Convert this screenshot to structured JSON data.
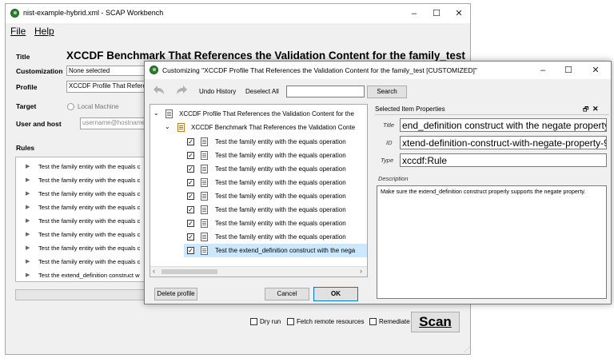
{
  "main_window": {
    "title": "nist-example-hybrid.xml - SCAP Workbench",
    "minimize": "–",
    "maximize": "☐",
    "close": "✕"
  },
  "menu": {
    "file": "File",
    "help": "Help"
  },
  "form": {
    "title_label": "Title",
    "title_value": "XCCDF Benchmark That References the Validation Content for the family_test",
    "customization_label": "Customization",
    "customization_value": "None selected",
    "profile_label": "Profile",
    "profile_value": "XCCDF Profile That References",
    "target_label": "Target",
    "local_machine": "Local Machine",
    "user_host_label": "User and host",
    "user_host_placeholder": "username@hostname",
    "rules_label": "Rules"
  },
  "rules": [
    "Test the family entity with the equals c",
    "Test the family entity with the equals c",
    "Test the family entity with the equals c",
    "Test the family entity with the equals c",
    "Test the family entity with the equals c",
    "Test the family entity with the equals c",
    "Test the family entity with the equals c",
    "Test the family entity with the equals c",
    "Test the extend_definition construct w"
  ],
  "bottom": {
    "dry_run": "Dry run",
    "fetch_remote": "Fetch remote resources",
    "remediate": "Remediate",
    "scan": "Scan"
  },
  "dialog": {
    "title": "Customizing \"XCCDF Profile That References the Validation Content for the family_test [CUSTOMIZED]\"",
    "minimize": "–",
    "maximize": "☐",
    "close": "✕",
    "undo_history": "Undo History",
    "deselect_all": "Deselect All",
    "search_value": "",
    "search_button": "Search",
    "tree_profile": "XCCDF Profile That References the Validation Content for the",
    "tree_benchmark": "XCCDF Benchmark That References the Validation Conte",
    "tree_items": [
      "Test the family entity with the equals operation",
      "Test the family entity with the equals operation",
      "Test the family entity with the equals operation",
      "Test the family entity with the equals operation",
      "Test the family entity with the equals operation",
      "Test the family entity with the equals operation",
      "Test the family entity with the equals operation",
      "Test the family entity with the equals operation",
      "Test the extend_definition construct with the nega"
    ],
    "delete_profile": "Delete profile",
    "cancel": "Cancel",
    "ok": "OK",
    "props_header": "Selected Item Properties",
    "title_field_label": "Title",
    "title_field_value": "end_definition construct with the negate property",
    "id_field_label": "ID",
    "id_field_value": "xtend-definition-construct-with-negate-property-9",
    "type_field_label": "Type",
    "type_field_value": "xccdf:Rule",
    "description_label": "Description",
    "description_value": "Make sure the extend_definition construct properly supports the negate property."
  }
}
